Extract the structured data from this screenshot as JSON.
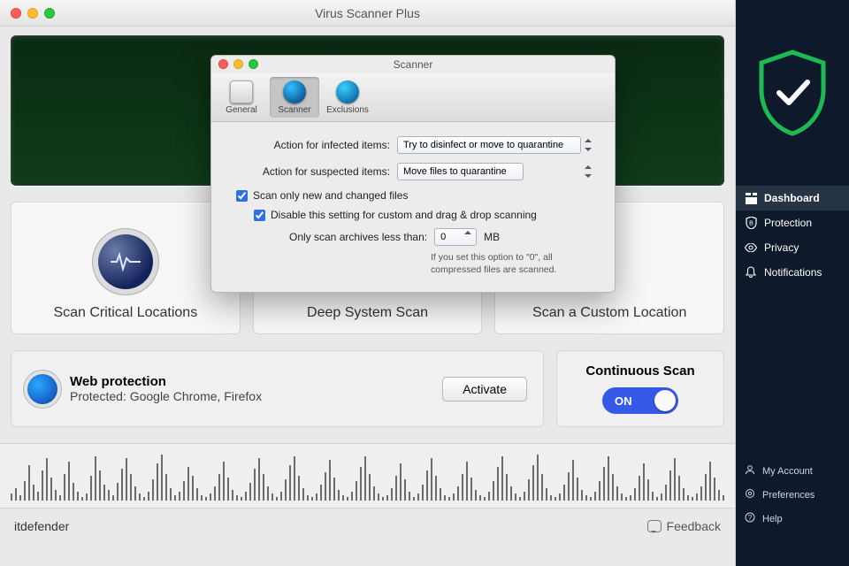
{
  "window": {
    "title": "Virus Scanner Plus"
  },
  "hero": {},
  "scan_cards": [
    {
      "label": "Scan Critical Locations",
      "icon": "pulse-icon"
    },
    {
      "label": "Deep System Scan",
      "icon": "deep-icon"
    },
    {
      "label": "Scan a Custom Location",
      "icon": "folder-icon"
    }
  ],
  "web_protection": {
    "heading": "Web protection",
    "status": "Protected: Google Chrome, Firefox",
    "button": "Activate"
  },
  "continuous_scan": {
    "heading": "Continuous Scan",
    "toggle_label": "ON",
    "on": true
  },
  "footer": {
    "brand_fragment": "itdefender",
    "feedback": "Feedback"
  },
  "modal": {
    "title": "Scanner",
    "tabs": [
      {
        "label": "General"
      },
      {
        "label": "Scanner"
      },
      {
        "label": "Exclusions"
      }
    ],
    "active_tab": 1,
    "infected_label": "Action for infected items:",
    "infected_value": "Try to disinfect or move to quarantine",
    "suspected_label": "Action for suspected items:",
    "suspected_value": "Move files to quarantine",
    "chk_new_changed": "Scan only new and changed files",
    "chk_disable_custom": "Disable this setting for custom and drag & drop scanning",
    "archives_label": "Only scan archives less than:",
    "archives_value": "0",
    "archives_unit": "MB",
    "archives_hint": "If you set this option to \"0\", all compressed files are scanned."
  },
  "right_sidebar": {
    "nav": [
      {
        "label": "Dashboard",
        "icon": "dashboard-icon",
        "active": true
      },
      {
        "label": "Protection",
        "icon": "shield-b-icon"
      },
      {
        "label": "Privacy",
        "icon": "eye-icon"
      },
      {
        "label": "Notifications",
        "icon": "bell-icon"
      }
    ],
    "bottom": [
      {
        "label": "My Account",
        "icon": "user-icon"
      },
      {
        "label": "Preferences",
        "icon": "gear-icon"
      },
      {
        "label": "Help",
        "icon": "help-icon"
      }
    ]
  }
}
